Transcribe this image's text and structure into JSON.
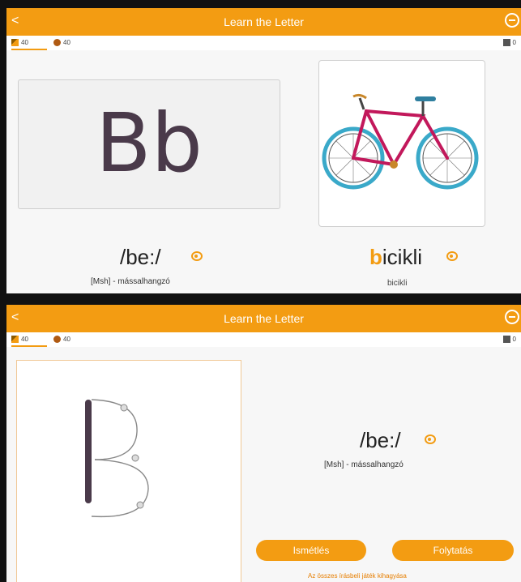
{
  "header": {
    "back_glyph": "<",
    "title": "Learn the Letter"
  },
  "stats": {
    "scribe": "40",
    "coins": "40",
    "pencils": "0"
  },
  "top": {
    "letter": "Bb",
    "phoneme": "/be:/",
    "description": "[Msh] - mássalhangzó",
    "word_first": "b",
    "word_rest": "icikli",
    "word_caption": "bicikli",
    "picture": "bicycle"
  },
  "bottom": {
    "phoneme": "/be:/",
    "description": "[Msh] - mássalhangzó",
    "repeat_button": "Ismétlés",
    "continue_button": "Folytatás",
    "skip_link": "Az összes írásbeli játék kihagyása"
  },
  "colors": {
    "accent": "#f39c12",
    "letter": "#4a3a4a"
  },
  "icons": [
    "scribe-icon",
    "coin-icon",
    "pencil-icon",
    "speaker-icon",
    "back-icon",
    "menu-icon"
  ]
}
